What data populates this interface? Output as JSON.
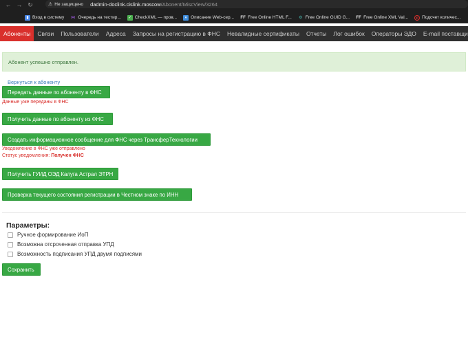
{
  "browser": {
    "security_label": "Не защищено",
    "url_host": "dadmin-doclink.cislink.moscow",
    "url_path": "/Abonent/MiscView/3264",
    "bookmarks": [
      {
        "label": "Вход в систему",
        "icon": "doc-icon",
        "color": "#4a88e8"
      },
      {
        "label": "Очередь на тестир...",
        "icon": "vs-icon",
        "color": "#9b59d9"
      },
      {
        "label": "CheckXML — пров...",
        "icon": "check-icon",
        "color": "#4caf50"
      },
      {
        "label": "Описание Web-сер...",
        "icon": "api-icon",
        "color": "#3d8bd9"
      },
      {
        "label": "Free Online HTML F...",
        "icon": "ff-icon",
        "color": "#e4e4e4"
      },
      {
        "label": "Free Online GUID G...",
        "icon": "guid-icon",
        "color": "#45b1a8"
      },
      {
        "label": "Free Online XML Val...",
        "icon": "ff-icon",
        "color": "#e4e4e4"
      },
      {
        "label": "Подсчет количес...",
        "icon": "counter-icon",
        "color": "#d9302c"
      }
    ]
  },
  "nav": {
    "items": [
      {
        "label": "Абоненты",
        "active": true
      },
      {
        "label": "Связи",
        "active": false
      },
      {
        "label": "Пользователи",
        "active": false
      },
      {
        "label": "Адреса",
        "active": false
      },
      {
        "label": "Запросы на регистрацию в ФНС",
        "active": false
      },
      {
        "label": "Невалидные сертификаты",
        "active": false
      },
      {
        "label": "Отчеты",
        "active": false
      },
      {
        "label": "Лог ошибок",
        "active": false
      },
      {
        "label": "Операторы ЭДО",
        "active": false
      },
      {
        "label": "E-mail поставщиков",
        "active": false
      }
    ]
  },
  "alert": {
    "text": "Абонент успешно отправлен."
  },
  "back_link": "Вернуться к абоненту",
  "actions": {
    "send_fns": "Передать данные по абоненту в ФНС",
    "send_fns_note": "Данные уже переданы в ФНС",
    "get_fns": "Получить данные по абоненту из ФНС",
    "create_message": "Создать информационное сообщение для ФНС через ТрансферТехнологии",
    "notice_sent": "Уведомление в ФНС уже отправлено",
    "notice_status_label": "Статус уведомления:",
    "notice_status_value": "Получен ФНС",
    "get_guid": "Получить ГУИД ОЭД Калуга Астрал ЭТРН",
    "check_honest_sign": "Проверка текущего состояния регистрации в Честном знаке по ИНН"
  },
  "params": {
    "title": "Параметры:",
    "options": [
      {
        "label": "Ручное формирование ИоП",
        "checked": false
      },
      {
        "label": "Возможна отсроченная отправка УПД",
        "checked": false
      },
      {
        "label": "Возможность подписания УПД двумя подписями",
        "checked": false
      }
    ],
    "save": "Сохранить"
  },
  "colors": {
    "accent_red": "#d9302c",
    "button_green": "#38a844",
    "alert_bg": "#dff0d8",
    "nav_bg": "#2f2f2f"
  }
}
